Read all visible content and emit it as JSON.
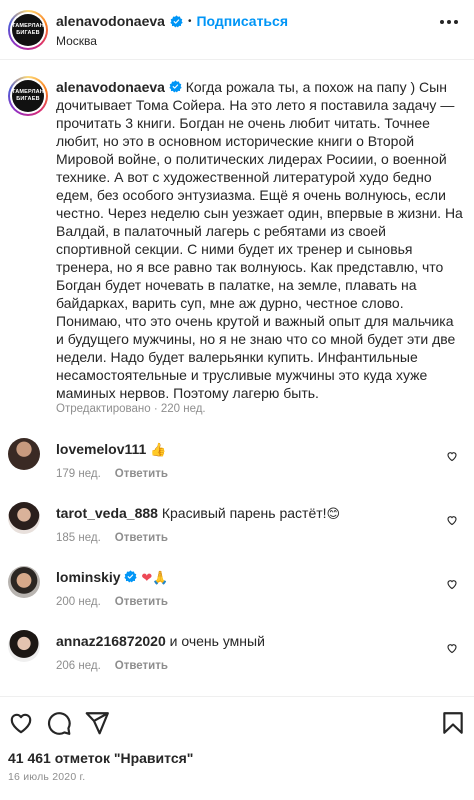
{
  "header": {
    "avatar_text_line1": "ТАМЕРЛАН",
    "avatar_text_line2": "БИГАЕВ",
    "username": "alenavodonaeva",
    "separator": "•",
    "follow_label": "Подписаться",
    "location": "Москва"
  },
  "caption": {
    "username": "alenavodonaeva",
    "text": "Когда рожала ты, а похож на папу ) Сын дочитывает Тома Сойера. На это лето я поставила задачу — прочитать 3 книги. Богдан не очень любит читать. Точнее любит, но это в основном исторические книги о Второй Мировой войне, о политических лидерах Росиии, о военной технике. А вот с художественной литературой худо бедно едем, без особого энтузиазма. Ещё я очень волнуюсь, если честно. Через неделю сын уезжает один, впервые в жизни. На Валдай, в палаточный лагерь с ребятами из своей спортивной секции. С ними будет их тренер и сыновья тренера, но я все равно так волнуюсь. Как представлю, что Богдан будет ночевать в палатке, на земле, плавать на байдарках, варить суп, мне аж дурно, честное слово. Понимаю, что это очень крутой и важный опыт для мальчика и будущего мужчины, но я не знаю что со мной будет эти две недели. Надо будет валерьянки купить. Инфантильные несамостоятельные и трусливые мужчины это куда хуже маминых нервов. Поэтому лагерю быть.",
    "meta": "Отредактировано · 220 нед."
  },
  "comments": [
    {
      "username": "lovemelov111",
      "text": "",
      "emoji": "👍",
      "time": "179 нед.",
      "reply": "Ответить"
    },
    {
      "username": "tarot_veda_888",
      "text": "Красивый парень растёт!",
      "emoji": "😊",
      "time": "185 нед.",
      "reply": "Ответить"
    },
    {
      "username": "lominskiy",
      "text": "",
      "emoji": "❤🙏",
      "time": "200 нед.",
      "reply": "Ответить"
    },
    {
      "username": "annaz216872020",
      "text": "и очень умный",
      "emoji": "",
      "time": "206 нед.",
      "reply": "Ответить"
    }
  ],
  "icons": {
    "like": "heart-icon",
    "comment": "comment-icon",
    "share": "share-icon",
    "save": "bookmark-icon",
    "verified": "verified-badge-icon",
    "more": "more-options-icon"
  },
  "colors": {
    "accent": "#0095f6",
    "text": "#262626",
    "secondary": "#8e8e8e",
    "like_red": "#ed4956"
  },
  "footer": {
    "likes": "41 461 отметок \"Нравится\"",
    "date": "16 июль 2020 г."
  }
}
